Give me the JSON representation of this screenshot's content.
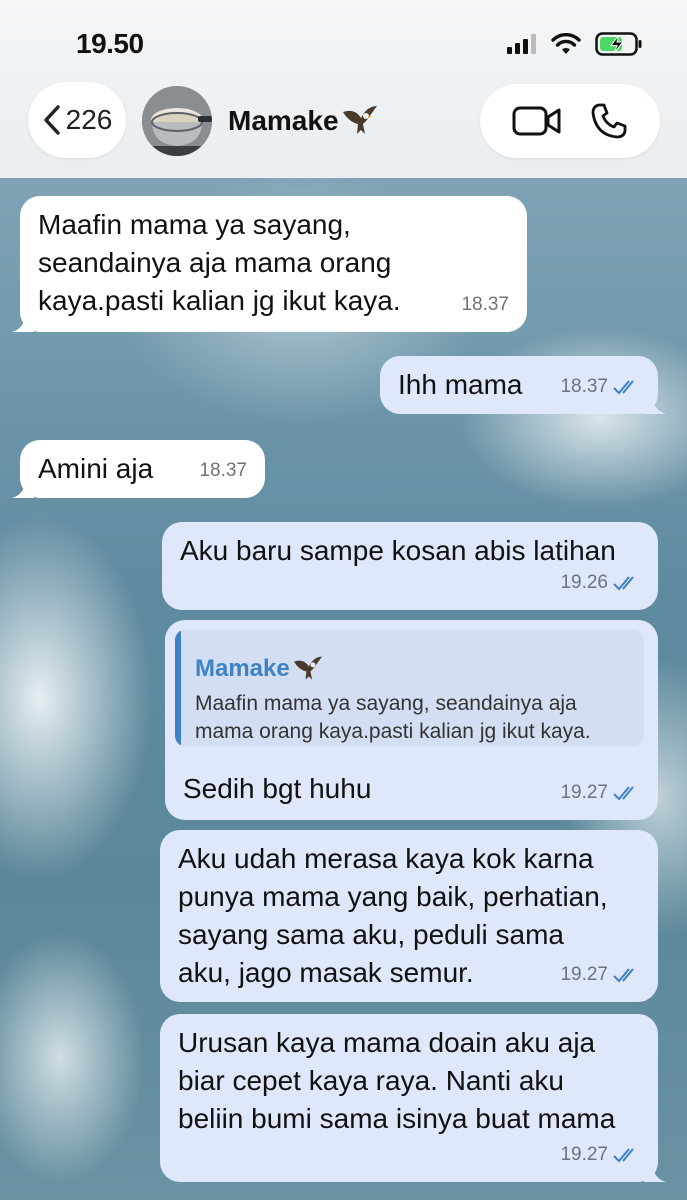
{
  "status_bar": {
    "time": "19.50"
  },
  "header": {
    "back_count": "226",
    "contact_name": "Mamake",
    "name_emoji_icon": "eagle-icon"
  },
  "messages": [
    {
      "direction": "in",
      "text": "Maafin mama ya sayang,\nseandainya aja mama orang\nkaya.pasti kalian jg ikut kaya.",
      "time": "18.37"
    },
    {
      "direction": "out",
      "text": "Ihh mama",
      "time": "18.37",
      "read": true
    },
    {
      "direction": "in",
      "text": "Amini aja",
      "time": "18.37"
    },
    {
      "direction": "out",
      "text": "Aku baru sampe kosan abis latihan",
      "time": "19.26",
      "read": true
    },
    {
      "direction": "out",
      "reply_to": {
        "name": "Mamake",
        "text": "Maafin mama ya sayang, seandainya aja\nmama orang kaya.pasti kalian jg ikut kaya."
      },
      "text": "Sedih bgt huhu",
      "time": "19.27",
      "read": true
    },
    {
      "direction": "out",
      "text": "Aku udah merasa kaya kok karna\npunya mama yang baik, perhatian,\nsayang sama aku, peduli sama\naku, jago masak semur.",
      "time": "19.27",
      "read": true
    },
    {
      "direction": "out",
      "text": "Urusan kaya mama doain aku aja\nbiar cepet kaya raya. Nanti aku\nbeliin bumi sama isinya buat mama",
      "time": "19.27",
      "read": true
    }
  ],
  "colors": {
    "outgoing_bubble": "#dfe7fb",
    "incoming_bubble": "#ffffff",
    "accent": "#3d82c4",
    "read_check": "#3d82c4"
  }
}
